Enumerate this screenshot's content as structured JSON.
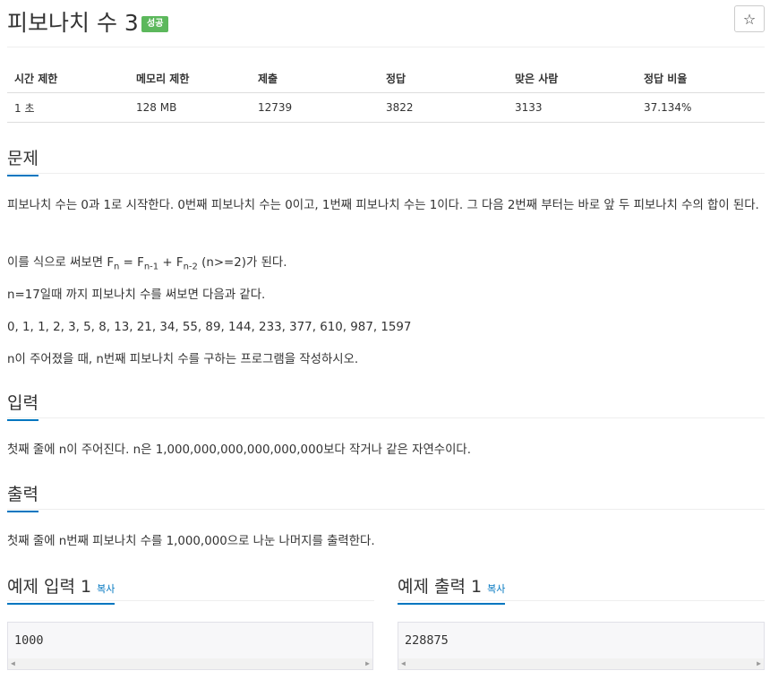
{
  "problem": {
    "title": "피보나치 수 3",
    "badge": "성공",
    "star_icon": "☆"
  },
  "stats": {
    "headers": [
      "시간 제한",
      "메모리 제한",
      "제출",
      "정답",
      "맞은 사람",
      "정답 비율"
    ],
    "values": [
      "1 초",
      "128 MB",
      "12739",
      "3822",
      "3133",
      "37.134%"
    ]
  },
  "sections": {
    "problem_title": "문제",
    "problem_p1": "피보나치 수는 0과 1로 시작한다. 0번째 피보나치 수는 0이고, 1번째 피보나치 수는 1이다. 그 다음 2번째 부터는 바로 앞 두 피보나치 수의 합이 된다.",
    "formula_prefix": "이를 식으로 써보면 F",
    "formula_sub_n": "n",
    "formula_mid1": " = F",
    "formula_sub_n1": "n-1",
    "formula_mid2": " + F",
    "formula_sub_n2": "n-2",
    "formula_suffix": " (n>=2)가 된다.",
    "problem_p3": "n=17일때 까지 피보나치 수를 써보면 다음과 같다.",
    "problem_p4": "0, 1, 1, 2, 3, 5, 8, 13, 21, 34, 55, 89, 144, 233, 377, 610, 987, 1597",
    "problem_p5": "n이 주어졌을 때, n번째 피보나치 수를 구하는 프로그램을 작성하시오.",
    "input_title": "입력",
    "input_text": "첫째 줄에 n이 주어진다. n은 1,000,000,000,000,000,000보다 작거나 같은 자연수이다.",
    "output_title": "출력",
    "output_text": "첫째 줄에 n번째 피보나치 수를 1,000,000으로 나눈 나머지를 출력한다."
  },
  "samples": {
    "input_title": "예제 입력 1",
    "output_title": "예제 출력 1",
    "copy_label": "복사",
    "input_value": "1000",
    "output_value": "228875"
  }
}
